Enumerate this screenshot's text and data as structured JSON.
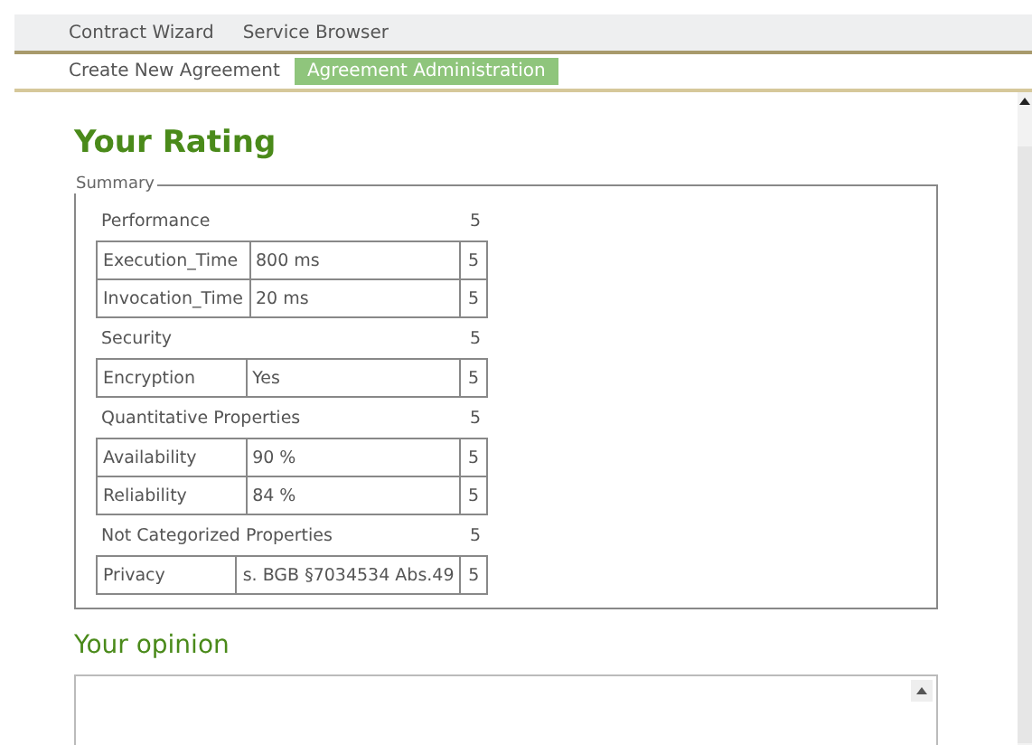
{
  "menu": [
    {
      "label": "Contract Wizard"
    },
    {
      "label": "Service Browser"
    }
  ],
  "tabs": [
    {
      "label": "Create New Agreement",
      "selected": false
    },
    {
      "label": "Agreement Administration",
      "selected": true
    }
  ],
  "rating": {
    "title": "Your Rating",
    "legend": "Summary",
    "groups": [
      {
        "name": "Performance",
        "score": "5",
        "rows": [
          {
            "property": "Execution_Time",
            "value": "800 ms",
            "score": "5"
          },
          {
            "property": "Invocation_Time",
            "value": "20 ms",
            "score": "5"
          }
        ]
      },
      {
        "name": "Security",
        "score": "5",
        "rows": [
          {
            "property": "Encryption",
            "value": "Yes",
            "score": "5"
          }
        ]
      },
      {
        "name": "Quantitative Properties",
        "score": "5",
        "rows": [
          {
            "property": "Availability",
            "value": "90 %",
            "score": "5"
          },
          {
            "property": "Reliability",
            "value": "84 %",
            "score": "5"
          }
        ]
      },
      {
        "name": "Not Categorized Properties",
        "score": "5",
        "rows": [
          {
            "property": "Privacy",
            "value": "s. BGB §7034534 Abs.49",
            "score": "5"
          }
        ]
      }
    ]
  },
  "opinion": {
    "title": "Your opinion"
  }
}
